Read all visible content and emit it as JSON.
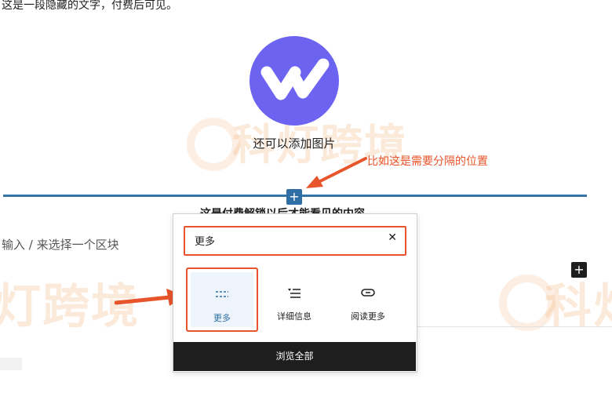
{
  "document": {
    "hidden_text": "这是一段隐藏的文字，付费后可见。",
    "image_caption": "还可以添加图片",
    "annotation": "比如这是需要分隔的位置",
    "paid_content_heading": "这是付费解锁以后才能看见的内容",
    "block_placeholder": "输入 / 来选择一个区块",
    "watermark_text_1": "科灯跨境",
    "watermark_text_2": "灯跨境",
    "watermark_text_3": "科灯"
  },
  "inserter": {
    "search_value": "更多",
    "clear_icon": "✕",
    "blocks": [
      {
        "label": "更多",
        "icon": "more-icon"
      },
      {
        "label": "详细信息",
        "icon": "details-icon"
      },
      {
        "label": "阅读更多",
        "icon": "read-more-icon"
      }
    ],
    "browse_all_label": "浏览全部"
  },
  "colors": {
    "accent": "#2f6fa5",
    "highlight": "#e8542b",
    "logo": "#6c63f0"
  }
}
